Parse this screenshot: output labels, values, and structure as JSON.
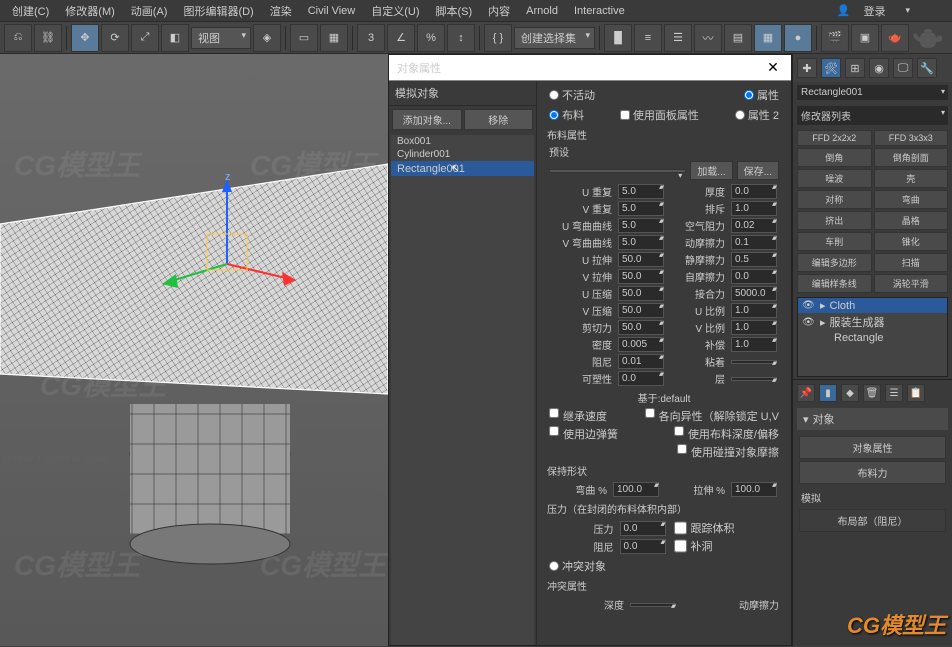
{
  "menu": {
    "create": "创建(C)",
    "modify": "修改器(M)",
    "anim": "动画(A)",
    "graph": "图形编辑器(D)",
    "render": "渲染",
    "civil": "Civil View",
    "custom": "自定义(U)",
    "script": "脚本(S)",
    "content": "内容",
    "arnold": "Arnold",
    "interactive": "Interactive"
  },
  "login": "登录",
  "toolbar": {
    "view": "视图",
    "selset": "创建选择集"
  },
  "dialog": {
    "title": "对象属性",
    "simobj": "模拟对象",
    "addobj": "添加对象...",
    "remove": "移除",
    "objects": [
      "Box001",
      "Cylinder001",
      "Rectangle001"
    ],
    "inactive": "不活动",
    "cloth": "布料",
    "usepanel": "使用面板属性",
    "prop": "属性",
    "prop2": "属性 2",
    "clothprops": "布料属性",
    "preset": "预设",
    "load": "加载...",
    "save": "保存...",
    "labels": {
      "urep": "U 重复",
      "urep_v": "5.0",
      "vrep": "V 重复",
      "vrep_v": "5.0",
      "ubend": "U 弯曲曲线",
      "ubend_v": "5.0",
      "vbend": "V 弯曲曲线",
      "vbend_v": "5.0",
      "ustr": "U 拉伸",
      "ustr_v": "50.0",
      "vstr": "V 拉伸",
      "vstr_v": "50.0",
      "ucomp": "U 压缩",
      "ucomp_v": "50.0",
      "vcomp": "V 压缩",
      "vcomp_v": "50.0",
      "shear": "剪切力",
      "shear_v": "50.0",
      "dens": "密度",
      "dens_v": "0.005",
      "damp": "阻尼",
      "damp_v": "0.01",
      "plast": "可塑性",
      "plast_v": "0.0",
      "thick": "厚度",
      "thick_v": "0.0",
      "repul": "排斥",
      "repul_v": "1.0",
      "air": "空气阻力",
      "air_v": "0.02",
      "dynfric": "动摩擦力",
      "dynfric_v": "0.1",
      "statfric": "静摩擦力",
      "statfric_v": "0.5",
      "selffric": "自摩擦力",
      "selffric_v": "0.0",
      "adh": "接合力",
      "adh_v": "5000.0",
      "uratio": "U 比例",
      "uratio_v": "1.0",
      "vratio": "V 比例",
      "vratio_v": "1.0",
      "comp": "补偿",
      "comp_v": "1.0",
      "stick": "粘着",
      "stick_v": "",
      "layer": "层",
      "layer_v": ""
    },
    "basedon": "基于:default",
    "inheritvel": "继承速度",
    "aniso": "各向异性（解除锁定 U,V",
    "edgespring": "使用边弹簧",
    "clothdepth": "使用布料深度/偏移",
    "collfric": "使用碰撞对象摩擦",
    "keepshape": "保持形状",
    "bendpct": "弯曲 %",
    "bendpct_v": "100.0",
    "strpct": "拉伸 %",
    "strpct_v": "100.0",
    "pressure_hdr": "压力（在封闭的布料体积内部）",
    "pressure": "压力",
    "pressure_v": "0.0",
    "damping2": "阻尼",
    "damping2_v": "0.0",
    "trackvol": "跟踪体积",
    "patch": "补洞",
    "collobj": "冲突对象",
    "collprops": "冲突属性",
    "depth": "深度",
    "depth_v": "",
    "anim_fric": "动摩擦力"
  },
  "right": {
    "objname": "Rectangle001",
    "modlist_label": "修改器列表",
    "mods": [
      "FFD 2x2x2",
      "FFD 3x3x3",
      "倒角",
      "倒角剖面",
      "噪波",
      "壳",
      "对称",
      "弯曲",
      "挤出",
      "晶格",
      "车削",
      "锥化",
      "编辑多边形",
      "扫描",
      "编辑样条线",
      "涡轮平滑"
    ],
    "stack": [
      {
        "name": "Cloth",
        "sel": true
      },
      {
        "name": "服装生成器",
        "sel": false
      },
      {
        "name": "Rectangle",
        "sel": false
      }
    ],
    "rollout_obj": "对象",
    "objprops_btn": "对象属性",
    "clothforce_btn": "布料力",
    "sim_label": "模拟",
    "local_sim": "布局部（阻尼）"
  },
  "watermark_text": "CG模型王"
}
